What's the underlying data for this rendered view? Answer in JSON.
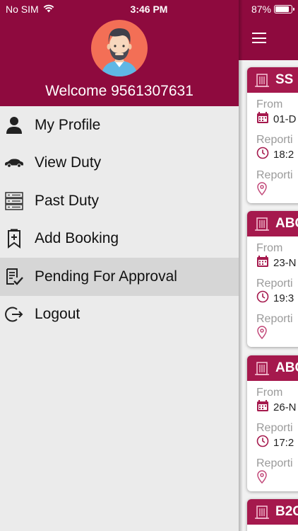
{
  "status_bar": {
    "carrier": "No SIM",
    "time": "3:46 PM",
    "battery": "87%",
    "battery_level": 0.87
  },
  "drawer": {
    "welcome": "Welcome 9561307631",
    "menu": [
      {
        "label": "My Profile",
        "icon": "person-icon"
      },
      {
        "label": "View Duty",
        "icon": "car-icon"
      },
      {
        "label": "Past Duty",
        "icon": "server-list-icon"
      },
      {
        "label": "Add Booking",
        "icon": "bookmark-add-icon"
      },
      {
        "label": "Pending For Approval",
        "icon": "checklist-icon",
        "active": true
      },
      {
        "label": "Logout",
        "icon": "logout-icon"
      }
    ]
  },
  "bookings": [
    {
      "title": "SS",
      "from_label": "From",
      "from_value": "01-D",
      "reporting_time_label": "Reporti",
      "reporting_time": "18:2",
      "reporting_place_label": "Reporti"
    },
    {
      "title": "ABC",
      "from_label": "From",
      "from_value": "23-N",
      "reporting_time_label": "Reporti",
      "reporting_time": "19:3",
      "reporting_place_label": "Reporti"
    },
    {
      "title": "ABC",
      "from_label": "From",
      "from_value": "26-N",
      "reporting_time_label": "Reporti",
      "reporting_time": "17:2",
      "reporting_place_label": "Reporti"
    },
    {
      "title": "B2C"
    }
  ],
  "colors": {
    "brand": "#8e0a3e",
    "card_header": "#a5194d",
    "drawer_bg": "#ebebeb",
    "active_item": "#d6d6d6"
  }
}
